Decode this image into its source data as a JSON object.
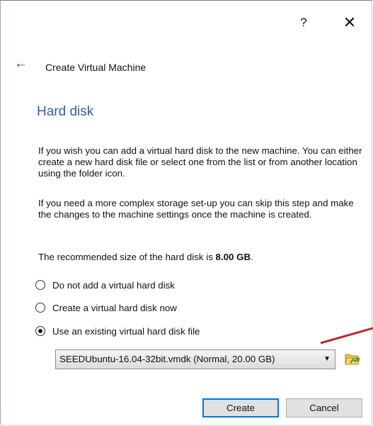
{
  "titlebar": {
    "help_label": "?",
    "close_label": "✕"
  },
  "wizard": {
    "back_icon": "arrow-left-icon",
    "title": "Create Virtual Machine",
    "page_heading": "Hard disk",
    "paragraph1": "If you wish you can add a virtual hard disk to the new machine. You can either create a new hard disk file or select one from the list or from another location using the folder icon.",
    "paragraph2": "If you need a more complex storage set-up you can skip this step and make the changes to the machine settings once the machine is created.",
    "recommended_prefix": "The recommended size of the hard disk is ",
    "recommended_size": "8.00 GB",
    "recommended_suffix": "."
  },
  "options": [
    {
      "label": "Do not add a virtual hard disk",
      "selected": false
    },
    {
      "label": "Create a virtual hard disk now",
      "selected": false
    },
    {
      "label": "Use an existing virtual hard disk file",
      "selected": true
    }
  ],
  "disk_select": {
    "value": "SEEDUbuntu-16.04-32bit.vmdk (Normal, 20.00 GB)",
    "icon": "folder-icon"
  },
  "buttons": {
    "create": "Create",
    "cancel": "Cancel"
  },
  "colors": {
    "heading": "#2f5ea8",
    "annotation_line": "#c0282e",
    "default_button_border": "#0078d7"
  }
}
